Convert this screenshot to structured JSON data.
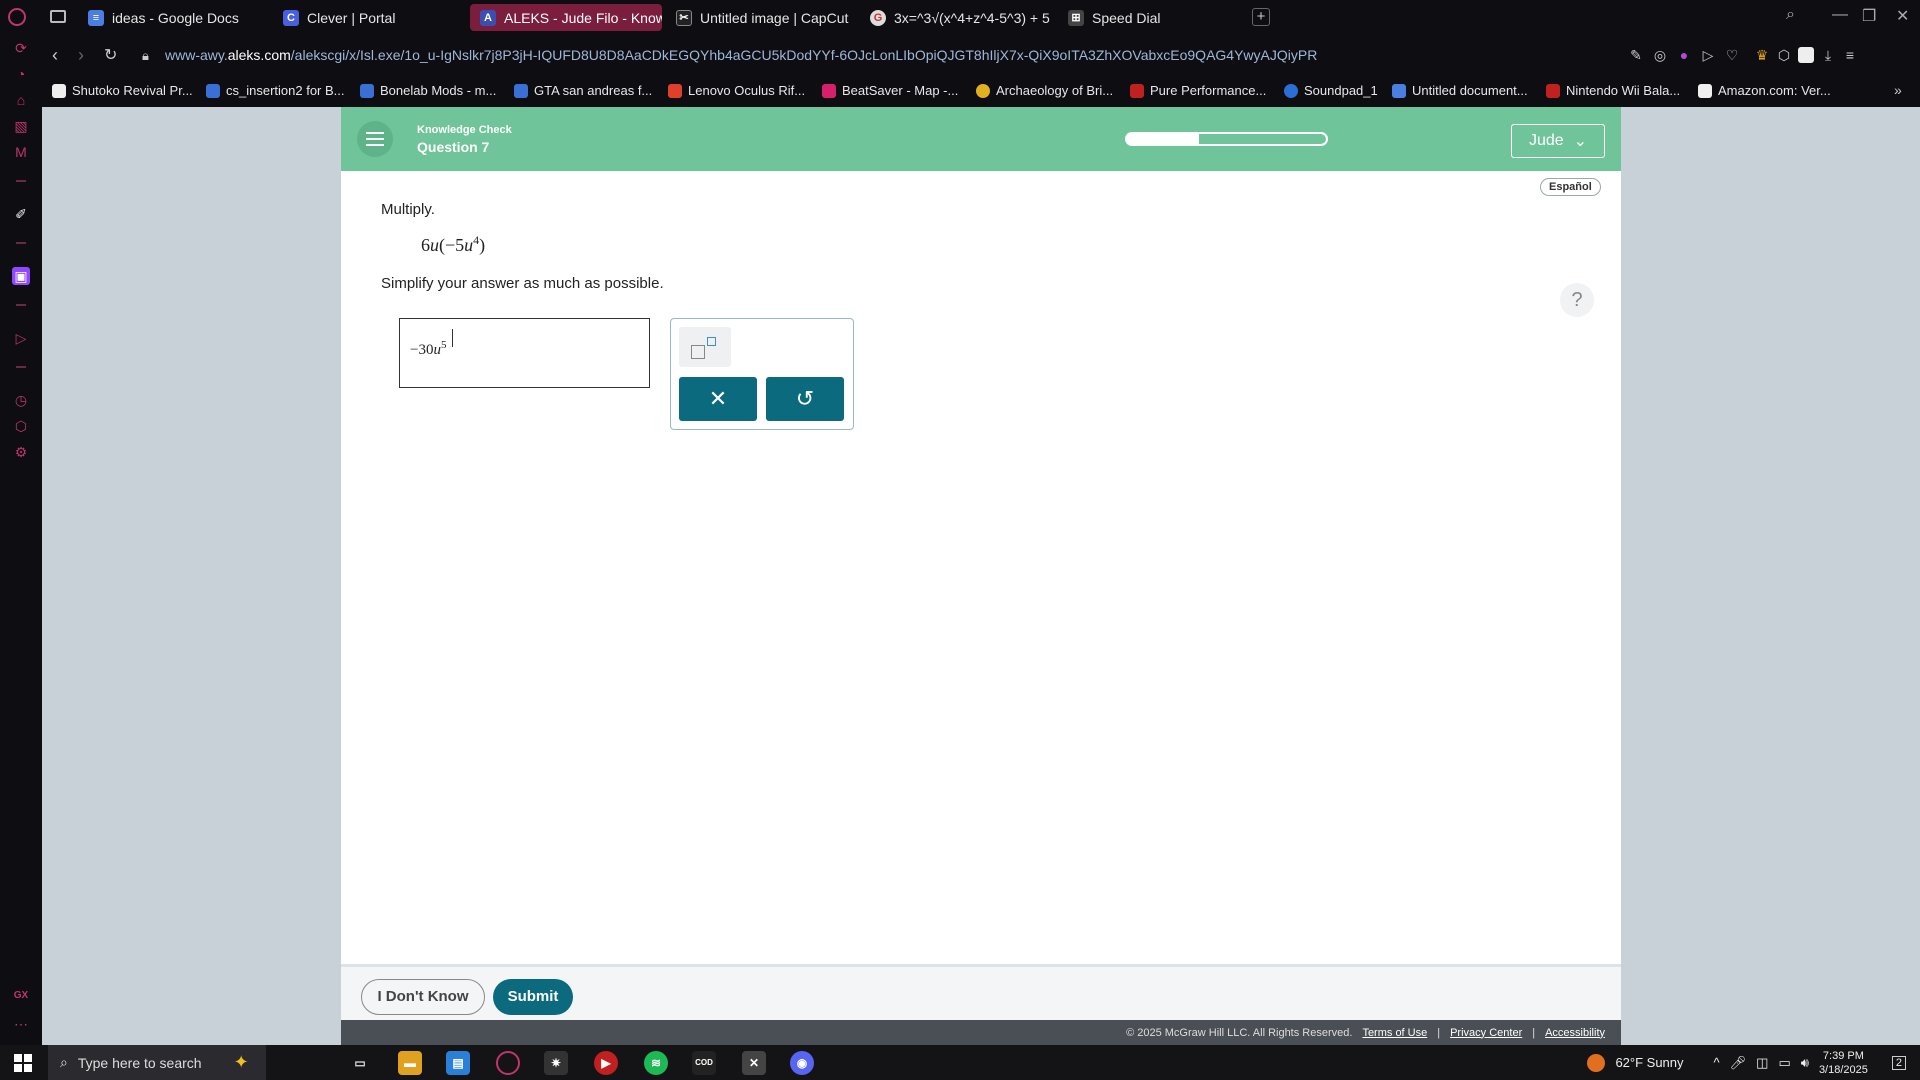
{
  "browser": {
    "tabs": [
      {
        "label": "ideas - Google Docs",
        "icon": "google-docs-icon",
        "color": "#4a7fe0"
      },
      {
        "label": "Clever | Portal",
        "icon": "clever-icon",
        "color": "#4a5fe0"
      },
      {
        "label": "ALEKS - Jude Filo - Knowle",
        "icon": "aleks-icon",
        "color": "#3b4fb0",
        "active": true
      },
      {
        "label": "Untitled image | CapCut",
        "icon": "capcut-icon",
        "color": "#222"
      },
      {
        "label": "3x=^3√(x^4+z^4-5^3) + 5",
        "icon": "google-icon",
        "color": "#ddd"
      },
      {
        "label": "Speed Dial",
        "icon": "speed-dial-icon",
        "color": "#444"
      }
    ],
    "url_prefix": "www-awy.",
    "url_domain": "aleks.com",
    "url_rest": "/alekscgi/x/Isl.exe/1o_u-IgNslkr7j8P3jH-IQUFD8U8D8AaCDkEGQYhb4aGCU5kDodYYf-6OJcLonLIbOpiQJGT8hIljX7x-QiX9oITA3ZhXOVabxcEo9QAG4YwyAJQiyPR",
    "bookmarks": [
      {
        "label": "Shutoko Revival Pr...",
        "color": "#eeeeee"
      },
      {
        "label": "cs_insertion2 for B...",
        "color": "#3a6fd6"
      },
      {
        "label": "Bonelab Mods - m...",
        "color": "#3a6fd6"
      },
      {
        "label": "GTA san andreas f...",
        "color": "#3a6fd6"
      },
      {
        "label": "Lenovo Oculus Rif...",
        "color": "#e0402a"
      },
      {
        "label": "BeatSaver - Map -...",
        "color": "#d6206b"
      },
      {
        "label": "Archaeology of Bri...",
        "color": "#e0b020"
      },
      {
        "label": "Pure Performance...",
        "color": "#c02020"
      },
      {
        "label": "Soundpad_1",
        "color": "#2a6fd6"
      },
      {
        "label": "Untitled document...",
        "color": "#4a7fe0"
      },
      {
        "label": "Nintendo Wii Bala...",
        "color": "#c02020"
      },
      {
        "label": "Amazon.com: Ver...",
        "color": "#f0f0f0"
      }
    ]
  },
  "aleks": {
    "header": {
      "section": "Knowledge Check",
      "question": "Question 7",
      "progress_fraction": 0.35,
      "user": "Jude"
    },
    "language_toggle": "Español",
    "help": "?",
    "problem": {
      "instruction": "Multiply.",
      "expr_coef": "6",
      "expr_var": "u",
      "expr_open": "(",
      "expr_inner_coef": "−5",
      "expr_inner_var": "u",
      "expr_inner_exp": "4",
      "expr_close": ")",
      "simplify": "Simplify your answer as much as possible."
    },
    "answer": {
      "coef": "−30",
      "var": "u",
      "exp": "5"
    },
    "tools": {
      "clear_symbol": "✕",
      "undo_symbol": "↺"
    },
    "footer": {
      "dont_know": "I Don't Know",
      "submit": "Submit",
      "copyright": "© 2025 McGraw Hill LLC. All Rights Reserved.",
      "terms": "Terms of Use",
      "privacy": "Privacy Center",
      "accessibility": "Accessibility",
      "sep": "|"
    }
  },
  "taskbar": {
    "search_placeholder": "Type here to search",
    "weather": "62°F  Sunny",
    "time": "7:39 PM",
    "date": "3/18/2025",
    "notifications": "2"
  }
}
